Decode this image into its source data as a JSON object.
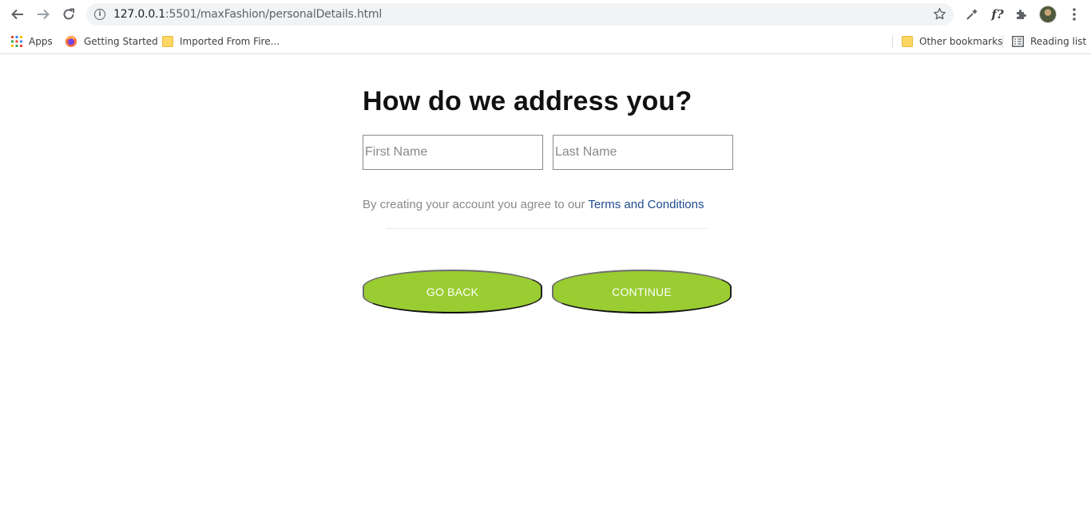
{
  "browser": {
    "url_host": "127.0.0.1",
    "url_path": ":5501/maxFashion/personalDetails.html",
    "extension_label": "f?",
    "bookmarks": {
      "left": [
        {
          "label": "Apps",
          "icon": "apps-grid-icon"
        },
        {
          "label": "Getting Started",
          "icon": "firefox-icon"
        },
        {
          "label": "Imported From Fire...",
          "icon": "folder-icon"
        }
      ],
      "right": [
        {
          "label": "Other bookmarks",
          "icon": "folder-icon"
        },
        {
          "label": "Reading list",
          "icon": "reading-list-icon"
        }
      ]
    }
  },
  "page": {
    "title": "How do we address you?",
    "first_name_placeholder": "First Name",
    "last_name_placeholder": "Last Name",
    "terms_prefix": "By creating your account you agree to our ",
    "terms_link": "Terms and Conditions",
    "go_back_label": "GO BACK",
    "continue_label": "CONTINUE"
  },
  "colors": {
    "button_green": "#9acd32",
    "link_blue": "#1f4b8f",
    "muted_text": "#8a8a8a"
  }
}
